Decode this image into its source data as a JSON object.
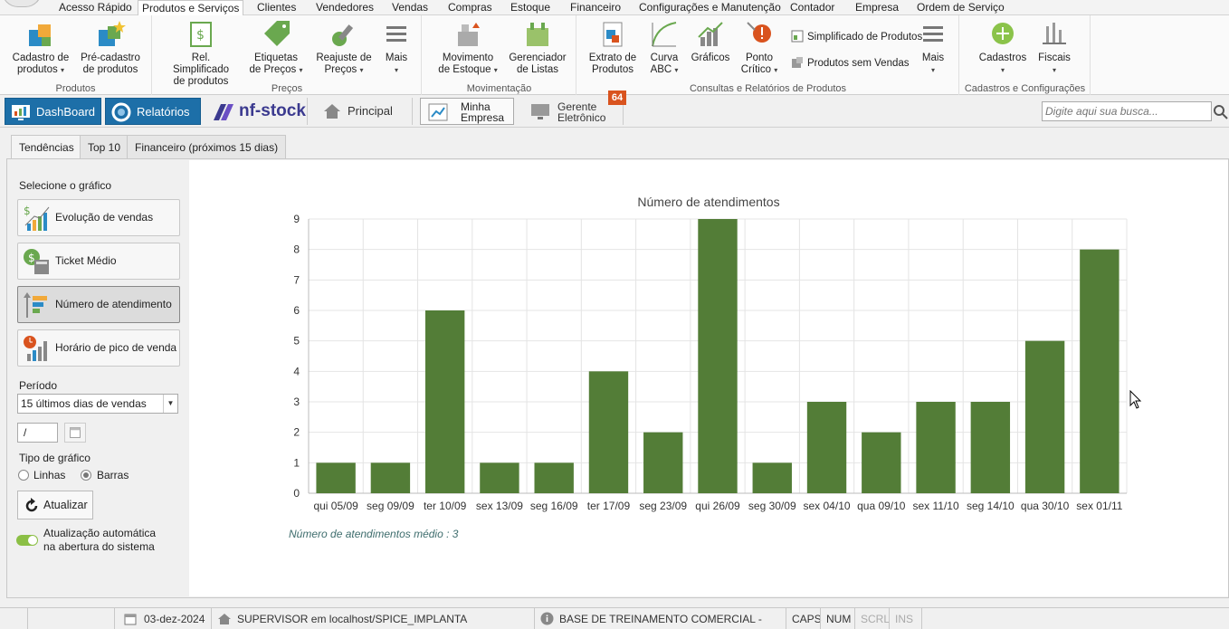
{
  "menu_tabs": [
    "Acesso Rápido",
    "Produtos e Serviços",
    "Clientes",
    "Vendedores",
    "Vendas",
    "Compras",
    "Estoque",
    "Financeiro",
    "Configurações e Manutenção",
    "Contador",
    "Empresa",
    "Ordem de Serviço"
  ],
  "ribbon": {
    "groups": {
      "produtos": "Produtos",
      "precos": "Preços",
      "movimentacao": "Movimentação",
      "consultas": "Consultas e Relatórios de Produtos",
      "cadastros": "Cadastros e Configurações"
    },
    "buttons": {
      "cadastro_produtos": [
        "Cadastro de",
        "produtos"
      ],
      "pre_cadastro": [
        "Pré-cadastro",
        "de produtos"
      ],
      "rel_simplificado": [
        "Rel. Simplificado",
        "de produtos"
      ],
      "etiquetas": [
        "Etiquetas",
        "de Preços"
      ],
      "reajuste": [
        "Reajuste de",
        "Preços"
      ],
      "mais1": "Mais",
      "movimento": [
        "Movimento",
        "de Estoque"
      ],
      "gerenciador": [
        "Gerenciador",
        "de Listas"
      ],
      "extrato": [
        "Extrato de",
        "Produtos"
      ],
      "curva": [
        "Curva",
        "ABC"
      ],
      "graficos": "Gráficos",
      "ponto": [
        "Ponto",
        "Crítico"
      ],
      "simplificado": "Simplificado de Produtos",
      "sem_vendas": "Produtos sem Vendas",
      "mais2": "Mais",
      "cadastros": "Cadastros",
      "fiscais": "Fiscais"
    }
  },
  "shortcuts": {
    "dashboard": "DashBoard",
    "relatorios": "Relatórios",
    "nfstock": "nf-stock",
    "principal": "Principal",
    "minha_empresa": [
      "Minha",
      "Empresa"
    ],
    "gerente": [
      "Gerente",
      "Eletrônico"
    ],
    "badge": "64",
    "search_placeholder": "Digite aqui sua busca..."
  },
  "content_tabs": [
    "Tendências",
    "Top 10",
    "Financeiro (próximos 15 dias)"
  ],
  "left_panel": {
    "select_label": "Selecione o gráfico",
    "graph_buttons": [
      "Evolução de vendas",
      "Ticket Médio",
      "Número de atendimento",
      "Horário de pico de venda"
    ],
    "active_graph": "Número de atendimento",
    "period_label": "Período",
    "period_value": "15 últimos dias de vendas",
    "date_value": "/",
    "chart_type_label": "Tipo de gráfico",
    "chart_type_options": [
      "Linhas",
      "Barras"
    ],
    "chart_type_selected": "Barras",
    "update_button": "Atualizar",
    "auto_update": [
      "Atualização automática",
      "na abertura do sistema"
    ],
    "auto_update_on": true
  },
  "chart_data": {
    "type": "bar",
    "title": "Número de atendimentos",
    "categories": [
      "qui 05/09",
      "seg 09/09",
      "ter 10/09",
      "sex 13/09",
      "seg 16/09",
      "ter 17/09",
      "seg 23/09",
      "qui 26/09",
      "seg 30/09",
      "sex 04/10",
      "qua 09/10",
      "sex 11/10",
      "seg 14/10",
      "qua 30/10",
      "sex 01/11"
    ],
    "values": [
      1,
      1,
      6,
      1,
      1,
      4,
      2,
      9,
      1,
      3,
      2,
      3,
      3,
      5,
      8
    ],
    "ylim": [
      0,
      9
    ],
    "yticks": [
      0,
      1,
      2,
      3,
      4,
      5,
      6,
      7,
      8,
      9
    ],
    "xlabel": "",
    "ylabel": "",
    "grid": true,
    "bar_color": "#537d37",
    "footer": "Número de atendimentos médio : 3"
  },
  "status_bar": {
    "date": "03-dez-2024",
    "user": "SUPERVISOR em localhost/SPICE_IMPLANTA",
    "base": "BASE DE TREINAMENTO COMERCIAL - INTENSIVO",
    "caps": "CAPS",
    "num": "NUM",
    "scrl": "SCRL",
    "ins": "INS"
  },
  "colors": {
    "accent_blue": "#1d6fa8",
    "bar_green": "#537d37",
    "badge_orange": "#d9531e"
  }
}
